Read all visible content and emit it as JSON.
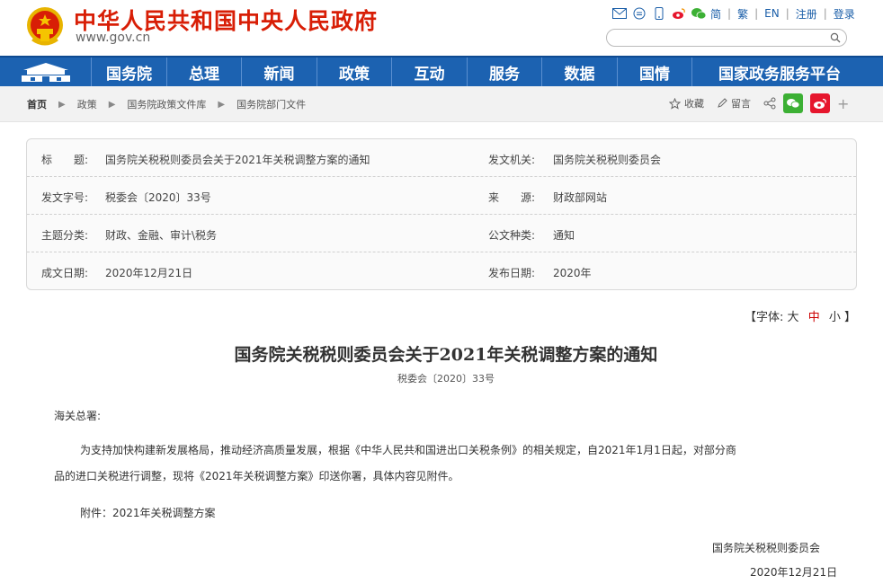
{
  "header": {
    "title": "中华人民共和国中央人民政府",
    "domain": "www.gov.cn",
    "links": [
      "简",
      "繁",
      "EN",
      "注册",
      "登录"
    ],
    "search_placeholder": ""
  },
  "nav": {
    "items": [
      "国务院",
      "总理",
      "新闻",
      "政策",
      "互动",
      "服务",
      "数据",
      "国情",
      "国家政务服务平台"
    ]
  },
  "breadcrumb": {
    "items": [
      "首页",
      "政策",
      "国务院政策文件库",
      "国务院部门文件"
    ]
  },
  "tools": {
    "favorite": "收藏",
    "message": "留言",
    "more": "+"
  },
  "info": {
    "title_label": "标　　题:",
    "title_value": "国务院关税税则委员会关于2021年关税调整方案的通知",
    "issuer_label": "发文机关:",
    "issuer_value": "国务院关税税则委员会",
    "docno_label": "发文字号:",
    "docno_value": "税委会〔2020〕33号",
    "source_label": "来　　源:",
    "source_value": "财政部网站",
    "topic_label": "主题分类:",
    "topic_value": "财政、金融、审计\\税务",
    "type_label": "公文种类:",
    "type_value": "通知",
    "written_label": "成文日期:",
    "written_value": "2020年12月21日",
    "published_label": "发布日期:",
    "published_value": "2020年"
  },
  "font_size": {
    "prefix": "【字体:",
    "large": "大",
    "medium": "中",
    "small": "小",
    "suffix": "】"
  },
  "article": {
    "title": "国务院关税税则委员会关于2021年关税调整方案的通知",
    "doc_number": "税委会〔2020〕33号",
    "salutation": "海关总署:",
    "body_line1": "为支持加快构建新发展格局，推动经济高质量发展，根据《中华人民共和国进出口关税条例》的相关规定，自2021年1月1日起，对部分商",
    "body_line2": "品的进口关税进行调整，现将《2021年关税调整方案》印送你署，具体内容见附件。",
    "attachment": "附件：2021年关税调整方案",
    "signature": "国务院关税税则委员会",
    "date": "2020年12月21日"
  },
  "colors": {
    "brand_red": "#d81e06",
    "nav_blue": "#1c62b1",
    "wechat_green": "#3cb034",
    "weibo_red": "#e6162d"
  }
}
